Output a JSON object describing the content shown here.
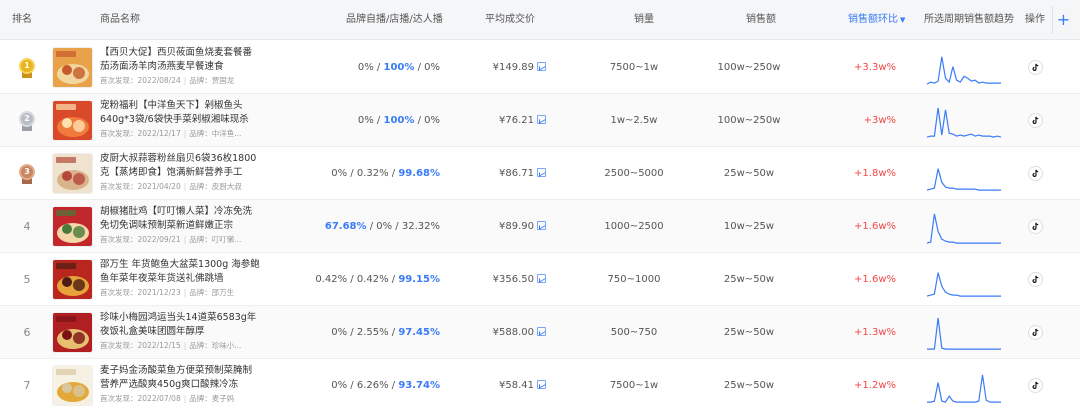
{
  "header": {
    "rank": "排名",
    "product": "商品名称",
    "ratio": "品牌自播/店播/达人播",
    "avg_price": "平均成交价",
    "sales": "销量",
    "amount": "销售额",
    "growth": "销售额环比",
    "trend": "所选周期销售额趋势",
    "action": "操作",
    "add": "+"
  },
  "meta_labels": {
    "first_seen": "首次发现：",
    "brand": "品牌："
  },
  "colors": {
    "accent": "#3a7bf7",
    "growth_up": "#f04848",
    "header_bg": "#f5f6f8"
  },
  "rows": [
    {
      "rank": "1",
      "medal": "gold",
      "name": "【西贝大促】西贝莜面鱼烧麦套餐番茄汤面汤羊肉汤燕麦早餐速食",
      "date": "2022/08/24",
      "brand": "贾国龙",
      "r1": "0%",
      "r2": "100%",
      "r3": "0%",
      "hi": 2,
      "price": "¥149.89",
      "sales": "7500~1w",
      "amount": "100w~250w",
      "growth": "+3.3w%",
      "trend": [
        2,
        4,
        3,
        5,
        30,
        8,
        4,
        20,
        6,
        4,
        10,
        8,
        5,
        6,
        3,
        4,
        3,
        3,
        3,
        3,
        3
      ],
      "thumb": [
        "#e8a24a",
        "#f3d7a0",
        "#c75a2c"
      ]
    },
    {
      "rank": "2",
      "medal": "silver",
      "name": "宠粉福利【中洋鱼天下】剁椒鱼头640g*3袋/6袋快手菜剁椒湘味现杀",
      "date": "2022/12/17",
      "brand": "中洋鱼...",
      "r1": "0%",
      "r2": "100%",
      "r3": "0%",
      "hi": 2,
      "price": "¥76.21",
      "sales": "1w~2.5w",
      "amount": "100w~250w",
      "growth": "+3w%",
      "trend": [
        2,
        3,
        3,
        32,
        4,
        30,
        6,
        5,
        3,
        4,
        3,
        4,
        5,
        3,
        4,
        3,
        3,
        3,
        2,
        3,
        2
      ],
      "thumb": [
        "#d84a2a",
        "#f07b3c",
        "#ffe1b0"
      ]
    },
    {
      "rank": "3",
      "medal": "bronze",
      "name": "皮厨大叔蒜蓉粉丝扇贝6袋36枚1800克【蒸烤即食】饱满新鲜营养手工",
      "date": "2021/04/20",
      "brand": "皮厨大叔",
      "r1": "0%",
      "r2": "0.32%",
      "r3": "99.68%",
      "hi": 3,
      "price": "¥86.71",
      "sales": "2500~5000",
      "amount": "25w~50w",
      "growth": "+1.8w%",
      "trend": [
        2,
        3,
        4,
        24,
        10,
        5,
        4,
        4,
        3,
        3,
        3,
        3,
        3,
        3,
        2,
        2,
        2,
        2,
        2,
        2,
        2
      ],
      "thumb": [
        "#efe3cf",
        "#d9b48a",
        "#b5483a"
      ]
    },
    {
      "rank": "4",
      "medal": "",
      "name": "胡椒猪肚鸡【叮叮懒人菜】冷冻免洗免切免调味预制菜新道鲜嫩正宗",
      "date": "2022/09/21",
      "brand": "叮叮懒...",
      "r1": "67.68%",
      "r2": "0%",
      "r3": "32.32%",
      "hi": 1,
      "price": "¥89.90",
      "sales": "1000~2500",
      "amount": "10w~25w",
      "growth": "+1.6w%",
      "trend": [
        2,
        3,
        32,
        14,
        6,
        4,
        3,
        3,
        2,
        2,
        2,
        2,
        2,
        2,
        2,
        2,
        2,
        2,
        2,
        2,
        2
      ],
      "thumb": [
        "#c1272d",
        "#f5d6a8",
        "#4a7a3a"
      ]
    },
    {
      "rank": "5",
      "medal": "",
      "name": "邵万生 年货鲍鱼大盆菜1300g 海参鲍鱼年菜年夜菜年货送礼佛跳墙",
      "date": "2021/12/23",
      "brand": "邵万生",
      "r1": "0.42%",
      "r2": "0.42%",
      "r3": "99.15%",
      "hi": 3,
      "price": "¥356.50",
      "sales": "750~1000",
      "amount": "25w~50w",
      "growth": "+1.6w%",
      "trend": [
        2,
        3,
        4,
        26,
        12,
        6,
        4,
        3,
        3,
        2,
        2,
        2,
        2,
        2,
        2,
        2,
        2,
        2,
        2,
        2,
        2
      ],
      "thumb": [
        "#b8261e",
        "#e7a23a",
        "#4b1d14"
      ]
    },
    {
      "rank": "6",
      "medal": "",
      "name": "珍味小梅园鸿运当头14道菜6583g年夜饭礼盒美味团圆年醇厚",
      "date": "2022/12/15",
      "brand": "珍味小...",
      "r1": "0%",
      "r2": "2.55%",
      "r3": "97.45%",
      "hi": 3,
      "price": "¥588.00",
      "sales": "500~750",
      "amount": "25w~50w",
      "growth": "+1.3w%",
      "trend": [
        2,
        2,
        2,
        34,
        3,
        2,
        2,
        2,
        2,
        2,
        2,
        2,
        2,
        2,
        2,
        2,
        2,
        2,
        2,
        2,
        2
      ],
      "thumb": [
        "#b01f22",
        "#e6c070",
        "#7a1216"
      ]
    },
    {
      "rank": "7",
      "medal": "",
      "name": "麦子妈金汤酸菜鱼方便菜预制菜腌制营养严选酸爽450g爽口酸辣冷冻",
      "date": "2022/07/08",
      "brand": "麦子妈",
      "r1": "0%",
      "r2": "6.26%",
      "r3": "93.74%",
      "hi": 3,
      "price": "¥58.41",
      "sales": "7500~1w",
      "amount": "25w~50w",
      "growth": "+1.2w%",
      "trend": [
        2,
        2,
        3,
        22,
        3,
        2,
        8,
        3,
        2,
        2,
        2,
        2,
        2,
        2,
        3,
        30,
        4,
        2,
        2,
        2,
        2
      ],
      "thumb": [
        "#f7f1e3",
        "#e2a93a",
        "#d8c7a0"
      ]
    }
  ]
}
